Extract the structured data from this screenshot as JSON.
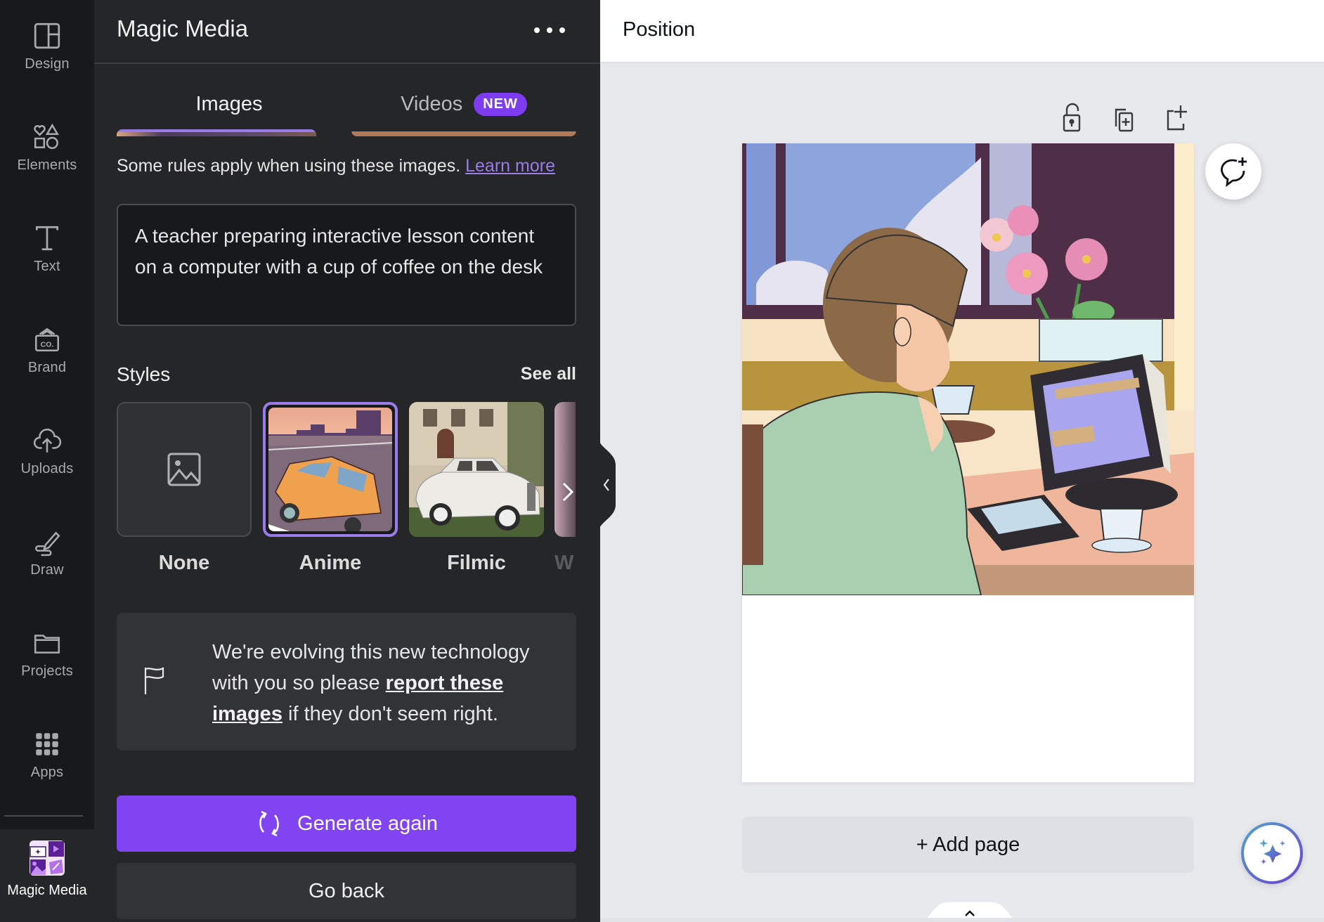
{
  "rail": {
    "items": [
      {
        "label": "Design",
        "icon": "layout-icon"
      },
      {
        "label": "Elements",
        "icon": "shapes-icon"
      },
      {
        "label": "Text",
        "icon": "text-icon"
      },
      {
        "label": "Brand",
        "icon": "brand-icon"
      },
      {
        "label": "Uploads",
        "icon": "cloud-upload-icon"
      },
      {
        "label": "Draw",
        "icon": "pen-icon"
      },
      {
        "label": "Projects",
        "icon": "folder-icon"
      },
      {
        "label": "Apps",
        "icon": "grid-icon"
      }
    ],
    "active": {
      "label": "Magic Media",
      "icon": "magic-media-icon"
    }
  },
  "panel": {
    "title": "Magic Media",
    "more_icon": "more-horizontal-icon",
    "tabs": [
      {
        "label": "Images",
        "selected": true
      },
      {
        "label": "Videos",
        "badge": "NEW",
        "selected": false
      }
    ],
    "rules_text": "Some rules apply when using these images.",
    "rules_link": "Learn more",
    "prompt_value": "A teacher preparing interactive lesson content on a computer with a cup of coffee on the desk",
    "styles": {
      "title": "Styles",
      "see_all": "See all",
      "items": [
        {
          "label": "None",
          "selected": false
        },
        {
          "label": "Anime",
          "selected": true
        },
        {
          "label": "Filmic",
          "selected": false
        },
        {
          "label": "W",
          "selected": false
        }
      ]
    },
    "notice": {
      "text_before": "We're evolving this new technology with you so please ",
      "link": "report these images",
      "text_after": " if they don't seem right."
    },
    "generate_label": "Generate again",
    "back_label": "Go back"
  },
  "canvas": {
    "header_title": "Position",
    "tools": [
      "lock-icon",
      "duplicate-page-icon",
      "add-page-icon"
    ],
    "add_page_label": "+ Add page",
    "accent": "#8144f2"
  }
}
